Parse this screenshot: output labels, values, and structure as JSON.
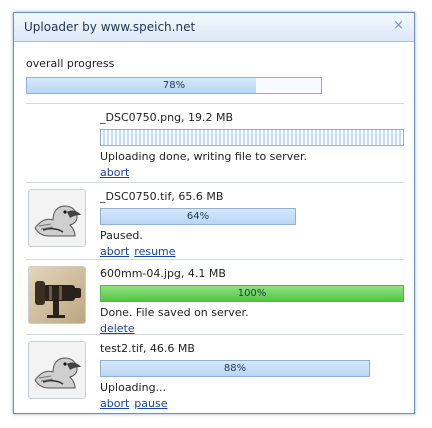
{
  "window": {
    "title": "Uploader by www.speich.net",
    "close_glyph": "×"
  },
  "overall": {
    "label": "overall progress",
    "percent": 78,
    "percent_text": "78%"
  },
  "items": [
    {
      "filename": "_DSC0750.png, 19.2 MB",
      "progress": 100,
      "progress_text": "",
      "status": "Uploading done, writing file to server.",
      "actions": [
        "abort"
      ],
      "has_thumbnail": false
    },
    {
      "filename": "_DSC0750.tif, 65.6 MB",
      "progress": 64,
      "progress_text": "64%",
      "status": "Paused.",
      "actions": [
        "abort",
        "resume"
      ],
      "has_thumbnail": true
    },
    {
      "filename": "600mm-04.jpg, 4.1 MB",
      "progress": 100,
      "progress_text": "100%",
      "status": "Done. File saved on server.",
      "actions": [
        "delete"
      ],
      "has_thumbnail": true
    },
    {
      "filename": "test2.tif, 46.6 MB",
      "progress": 88,
      "progress_text": "88%",
      "status": "Uploading...",
      "actions": [
        "abort",
        "pause"
      ],
      "has_thumbnail": true
    }
  ],
  "colors": {
    "bar_fill": "#c6dcf4",
    "bar_border": "#8fb0d8",
    "done_fill": "#55c446",
    "link": "#1a44a8"
  }
}
